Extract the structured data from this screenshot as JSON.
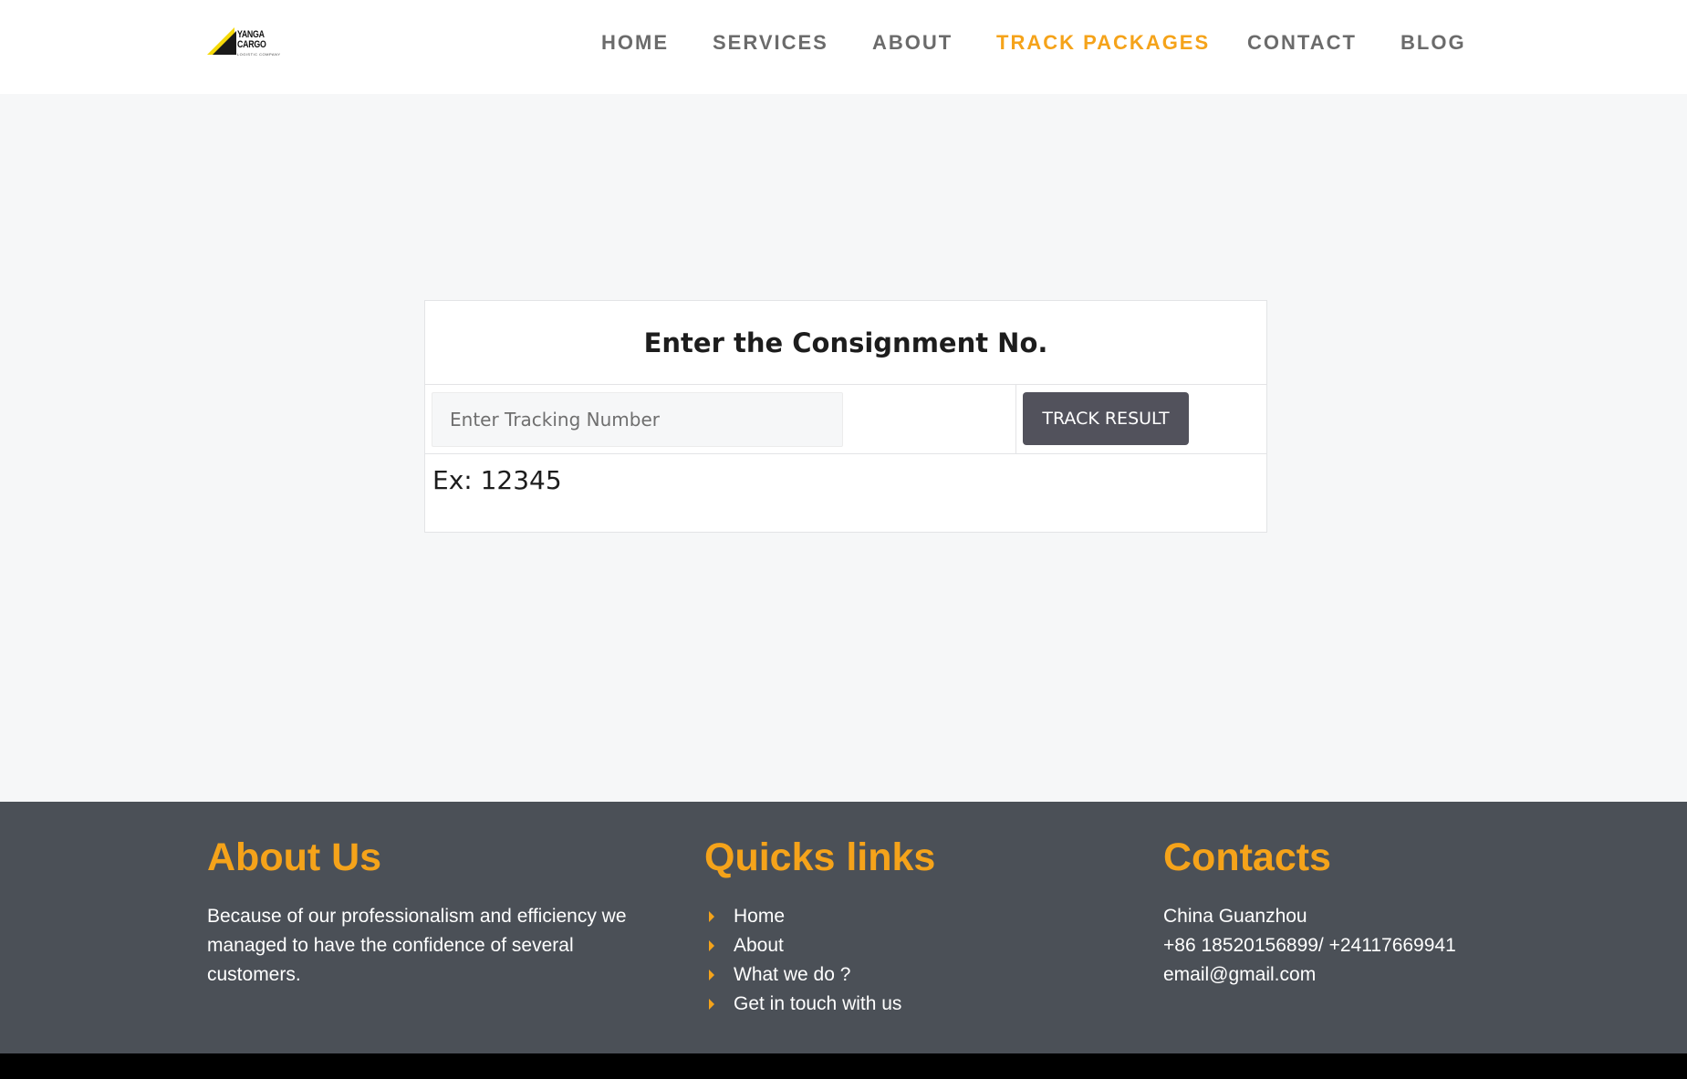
{
  "brand": {
    "name": "YANGA CARGO",
    "tagline": "LOGISTIC COMPANY"
  },
  "nav": {
    "items": [
      {
        "label": "HOME",
        "active": false
      },
      {
        "label": "SERVICES",
        "active": false
      },
      {
        "label": "ABOUT",
        "active": false
      },
      {
        "label": "TRACK PACKAGES",
        "active": true
      },
      {
        "label": "CONTACT",
        "active": false
      },
      {
        "label": "BLOG",
        "active": false
      }
    ]
  },
  "tracking": {
    "title": "Enter the Consignment No.",
    "input_placeholder": "Enter Tracking Number",
    "input_value": "",
    "button_label": "TRACK RESULT",
    "example": "Ex: 12345"
  },
  "footer": {
    "about": {
      "heading": "About Us",
      "lines": [
        "Because of our  professionalism and efficiency we",
        "managed to have the confidence of several",
        "customers."
      ]
    },
    "links": {
      "heading": "Quicks links",
      "items": [
        "Home",
        "About",
        "What we do ?",
        "Get in touch with us"
      ]
    },
    "contacts": {
      "heading": "Contacts",
      "location": "China Guanzhou",
      "phone": "+86 18520156899/ +24117669941",
      "email": "email@gmail.com"
    }
  },
  "colors": {
    "accent": "#f5a31a",
    "nav_text": "#6b6b6b",
    "button_bg": "#52525c",
    "footer_bg": "#4b5057",
    "page_bg": "#f6f7f8"
  }
}
